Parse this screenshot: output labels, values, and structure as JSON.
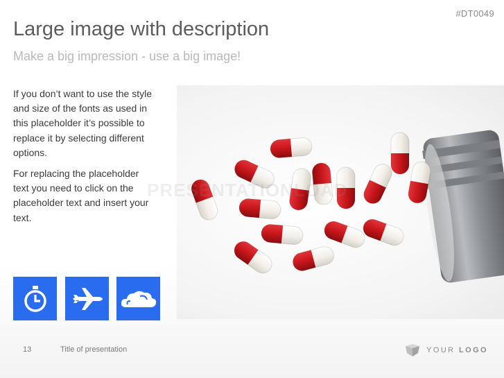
{
  "header": {
    "code": "#DT0049",
    "title": "Large image with description",
    "subtitle": "Make a big impression - use a big image!"
  },
  "body": {
    "paragraph1": "If you don’t want to use the style and size of the fonts as used in this placeholder it’s possible to replace it by selecting different options.",
    "paragraph2": "For replacing the placeholder text you need to click on the placeholder text and insert your text."
  },
  "icons": [
    {
      "name": "stopwatch-icon"
    },
    {
      "name": "airplane-icon"
    },
    {
      "name": "cloud-icon"
    }
  ],
  "colors": {
    "tile_blue": "#2a6cf0",
    "capsule_red": "#c8161b",
    "capsule_white": "#f2efe9"
  },
  "watermark": "PRESENTATIONLOAD",
  "footer": {
    "page_number": "13",
    "presentation_title": "Title of presentation",
    "logo_word1": "YOUR",
    "logo_word2": "LOGO"
  }
}
